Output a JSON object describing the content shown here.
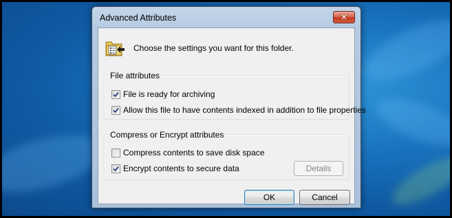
{
  "window": {
    "title": "Advanced Attributes",
    "close_label": "✕"
  },
  "header": {
    "text": "Choose the settings you want for this folder."
  },
  "file_attributes": {
    "label": "File attributes",
    "options": [
      {
        "label": "File is ready for archiving",
        "checked": true
      },
      {
        "label": "Allow this file to have contents indexed in addition to file properties",
        "checked": true
      }
    ]
  },
  "compress_encrypt": {
    "label": "Compress or Encrypt attributes",
    "options": [
      {
        "label": "Compress contents to save disk space",
        "checked": false
      },
      {
        "label": "Encrypt contents to secure data",
        "checked": true
      }
    ],
    "details_label": "Details"
  },
  "buttons": {
    "ok": "OK",
    "cancel": "Cancel"
  },
  "icons": {
    "title_close": "close-icon",
    "folder": "folder-attributes-icon"
  }
}
